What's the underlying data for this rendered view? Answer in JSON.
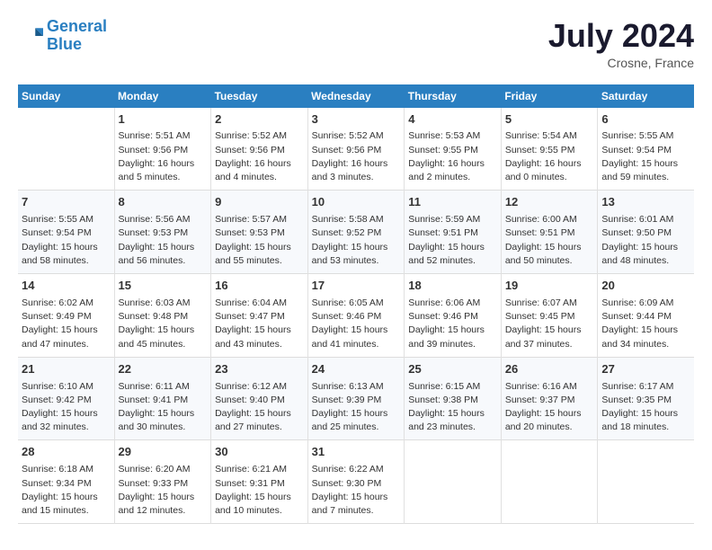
{
  "header": {
    "logo_line1": "General",
    "logo_line2": "Blue",
    "month_year": "July 2024",
    "location": "Crosne, France"
  },
  "days_of_week": [
    "Sunday",
    "Monday",
    "Tuesday",
    "Wednesday",
    "Thursday",
    "Friday",
    "Saturday"
  ],
  "weeks": [
    [
      {
        "day": "",
        "info": ""
      },
      {
        "day": "1",
        "info": "Sunrise: 5:51 AM\nSunset: 9:56 PM\nDaylight: 16 hours\nand 5 minutes."
      },
      {
        "day": "2",
        "info": "Sunrise: 5:52 AM\nSunset: 9:56 PM\nDaylight: 16 hours\nand 4 minutes."
      },
      {
        "day": "3",
        "info": "Sunrise: 5:52 AM\nSunset: 9:56 PM\nDaylight: 16 hours\nand 3 minutes."
      },
      {
        "day": "4",
        "info": "Sunrise: 5:53 AM\nSunset: 9:55 PM\nDaylight: 16 hours\nand 2 minutes."
      },
      {
        "day": "5",
        "info": "Sunrise: 5:54 AM\nSunset: 9:55 PM\nDaylight: 16 hours\nand 0 minutes."
      },
      {
        "day": "6",
        "info": "Sunrise: 5:55 AM\nSunset: 9:54 PM\nDaylight: 15 hours\nand 59 minutes."
      }
    ],
    [
      {
        "day": "7",
        "info": "Sunrise: 5:55 AM\nSunset: 9:54 PM\nDaylight: 15 hours\nand 58 minutes."
      },
      {
        "day": "8",
        "info": "Sunrise: 5:56 AM\nSunset: 9:53 PM\nDaylight: 15 hours\nand 56 minutes."
      },
      {
        "day": "9",
        "info": "Sunrise: 5:57 AM\nSunset: 9:53 PM\nDaylight: 15 hours\nand 55 minutes."
      },
      {
        "day": "10",
        "info": "Sunrise: 5:58 AM\nSunset: 9:52 PM\nDaylight: 15 hours\nand 53 minutes."
      },
      {
        "day": "11",
        "info": "Sunrise: 5:59 AM\nSunset: 9:51 PM\nDaylight: 15 hours\nand 52 minutes."
      },
      {
        "day": "12",
        "info": "Sunrise: 6:00 AM\nSunset: 9:51 PM\nDaylight: 15 hours\nand 50 minutes."
      },
      {
        "day": "13",
        "info": "Sunrise: 6:01 AM\nSunset: 9:50 PM\nDaylight: 15 hours\nand 48 minutes."
      }
    ],
    [
      {
        "day": "14",
        "info": "Sunrise: 6:02 AM\nSunset: 9:49 PM\nDaylight: 15 hours\nand 47 minutes."
      },
      {
        "day": "15",
        "info": "Sunrise: 6:03 AM\nSunset: 9:48 PM\nDaylight: 15 hours\nand 45 minutes."
      },
      {
        "day": "16",
        "info": "Sunrise: 6:04 AM\nSunset: 9:47 PM\nDaylight: 15 hours\nand 43 minutes."
      },
      {
        "day": "17",
        "info": "Sunrise: 6:05 AM\nSunset: 9:46 PM\nDaylight: 15 hours\nand 41 minutes."
      },
      {
        "day": "18",
        "info": "Sunrise: 6:06 AM\nSunset: 9:46 PM\nDaylight: 15 hours\nand 39 minutes."
      },
      {
        "day": "19",
        "info": "Sunrise: 6:07 AM\nSunset: 9:45 PM\nDaylight: 15 hours\nand 37 minutes."
      },
      {
        "day": "20",
        "info": "Sunrise: 6:09 AM\nSunset: 9:44 PM\nDaylight: 15 hours\nand 34 minutes."
      }
    ],
    [
      {
        "day": "21",
        "info": "Sunrise: 6:10 AM\nSunset: 9:42 PM\nDaylight: 15 hours\nand 32 minutes."
      },
      {
        "day": "22",
        "info": "Sunrise: 6:11 AM\nSunset: 9:41 PM\nDaylight: 15 hours\nand 30 minutes."
      },
      {
        "day": "23",
        "info": "Sunrise: 6:12 AM\nSunset: 9:40 PM\nDaylight: 15 hours\nand 27 minutes."
      },
      {
        "day": "24",
        "info": "Sunrise: 6:13 AM\nSunset: 9:39 PM\nDaylight: 15 hours\nand 25 minutes."
      },
      {
        "day": "25",
        "info": "Sunrise: 6:15 AM\nSunset: 9:38 PM\nDaylight: 15 hours\nand 23 minutes."
      },
      {
        "day": "26",
        "info": "Sunrise: 6:16 AM\nSunset: 9:37 PM\nDaylight: 15 hours\nand 20 minutes."
      },
      {
        "day": "27",
        "info": "Sunrise: 6:17 AM\nSunset: 9:35 PM\nDaylight: 15 hours\nand 18 minutes."
      }
    ],
    [
      {
        "day": "28",
        "info": "Sunrise: 6:18 AM\nSunset: 9:34 PM\nDaylight: 15 hours\nand 15 minutes."
      },
      {
        "day": "29",
        "info": "Sunrise: 6:20 AM\nSunset: 9:33 PM\nDaylight: 15 hours\nand 12 minutes."
      },
      {
        "day": "30",
        "info": "Sunrise: 6:21 AM\nSunset: 9:31 PM\nDaylight: 15 hours\nand 10 minutes."
      },
      {
        "day": "31",
        "info": "Sunrise: 6:22 AM\nSunset: 9:30 PM\nDaylight: 15 hours\nand 7 minutes."
      },
      {
        "day": "",
        "info": ""
      },
      {
        "day": "",
        "info": ""
      },
      {
        "day": "",
        "info": ""
      }
    ]
  ]
}
